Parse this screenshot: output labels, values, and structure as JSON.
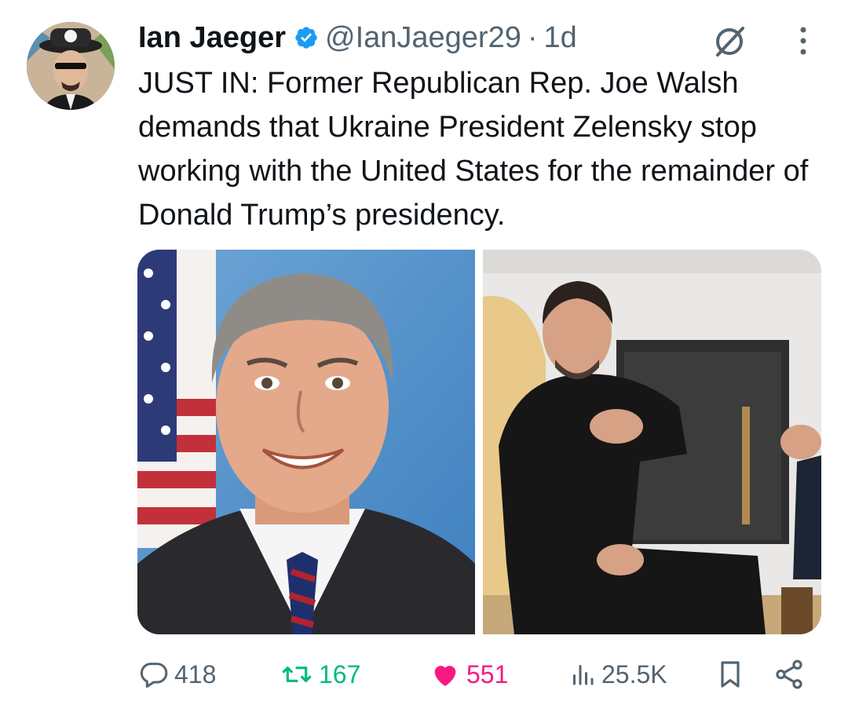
{
  "tweet": {
    "author_name": "Ian Jaeger",
    "handle": "@IanJaeger29",
    "separator": "·",
    "time": "1d",
    "text": "JUST IN: Former Republican Rep. Joe Walsh demands that Ukraine President Zelensky stop working with the United States for the remainder of Donald Trump’s presidency."
  },
  "icons": {
    "verified": "verified-badge-icon",
    "grok": "grok-icon",
    "more": "more-vertical-icon",
    "reply": "reply-bubble-icon",
    "retweet": "retweet-icon",
    "like": "heart-filled-icon",
    "views": "views-bar-chart-icon",
    "bookmark": "bookmark-icon",
    "share": "share-icon"
  },
  "metrics": {
    "replies": "418",
    "retweets": "167",
    "likes": "551",
    "views": "25.5K"
  },
  "colors": {
    "verified": "#1d9bf0",
    "retweet": "#00ba7c",
    "like": "#f91880",
    "muted": "#536471",
    "text": "#0f1419"
  }
}
